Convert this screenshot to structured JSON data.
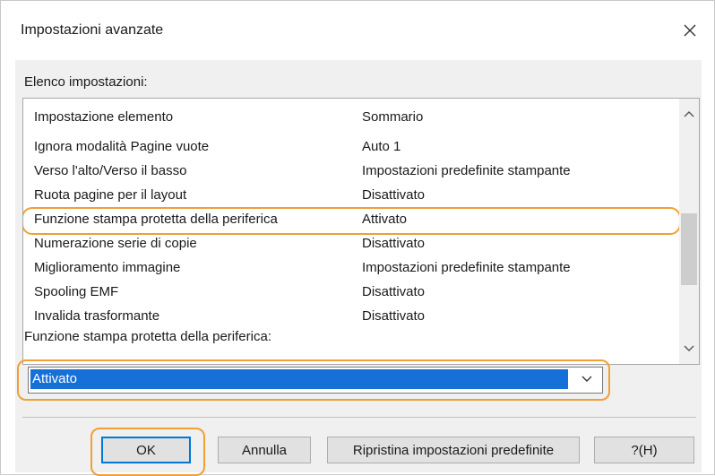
{
  "dialog": {
    "title": "Impostazioni avanzate",
    "close_icon": "close-icon"
  },
  "settings_list": {
    "label": "Elenco impostazioni:",
    "columns": [
      "Impostazione elemento",
      "Sommario"
    ],
    "rows": [
      {
        "item": "Ignora modalità Pagine vuote",
        "summary": "Auto 1"
      },
      {
        "item": "Verso l'alto/Verso il basso",
        "summary": "Impostazioni predefinite stampante"
      },
      {
        "item": "Ruota pagine per il layout",
        "summary": "Disattivato"
      },
      {
        "item": "Funzione stampa protetta della periferica",
        "summary": "Attivato"
      },
      {
        "item": "Numerazione serie di copie",
        "summary": "Disattivato"
      },
      {
        "item": "Miglioramento immagine",
        "summary": "Impostazioni predefinite stampante"
      },
      {
        "item": "Spooling EMF",
        "summary": "Disattivato"
      },
      {
        "item": "Invalida trasformante",
        "summary": "Disattivato"
      }
    ],
    "highlighted_row": "Funzione stampa protetta della periferica"
  },
  "detail": {
    "label": "Funzione stampa protetta della periferica:",
    "selected_value": "Attivato"
  },
  "buttons": {
    "ok": "OK",
    "cancel": "Annulla",
    "restore": "Ripristina impostazioni predefinite",
    "help": "?(H)"
  },
  "colors": {
    "highlight_outline": "#f0a035",
    "selection": "#1670d8",
    "default_button_border": "#0078d7"
  }
}
